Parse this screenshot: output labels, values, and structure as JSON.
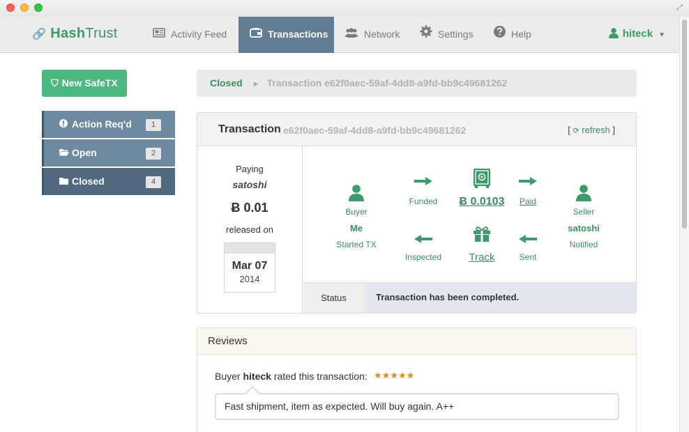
{
  "app": {
    "brand_part1": "Hash",
    "brand_part2": "Trust"
  },
  "nav": {
    "items": [
      {
        "label": "Activity Feed",
        "icon": "newspaper-icon"
      },
      {
        "label": "Transactions",
        "icon": "wallet-icon",
        "active": true
      },
      {
        "label": "Network",
        "icon": "users-icon"
      },
      {
        "label": "Settings",
        "icon": "gear-icon"
      },
      {
        "label": "Help",
        "icon": "question-icon"
      }
    ],
    "user": "hiteck"
  },
  "sidebar": {
    "new_button": "New SafeTX",
    "items": [
      {
        "label": "Action Req'd",
        "count": "1",
        "icon": "exclamation-icon"
      },
      {
        "label": "Open",
        "count": "2",
        "icon": "folder-open-icon"
      },
      {
        "label": "Closed",
        "count": "4",
        "icon": "folder-icon"
      }
    ]
  },
  "breadcrumb": {
    "section": "Closed",
    "current": "Transaction e62f0aec-59af-4dd8-a9fd-bb9c49681262"
  },
  "transaction": {
    "title": "Transaction",
    "id": "e62f0aec-59af-4dd8-a9fd-bb9c49681262",
    "refresh_label": "refresh",
    "paying_label": "Paying",
    "payee": "satoshi",
    "amount": "Ƀ 0.01",
    "released_label": "released on",
    "date_md": "Mar 07",
    "date_year": "2014",
    "flow": {
      "buyer_role": "Buyer",
      "buyer_name": "Me",
      "buyer_state": "Started TX",
      "funded": "Funded",
      "escrow_amount": "Ƀ 0.0103",
      "paid": "Paid",
      "seller_role": "Seller",
      "seller_name": "satoshi",
      "seller_state": "Notified",
      "inspected": "Inspected",
      "track": "Track",
      "sent": "Sent"
    },
    "status_label": "Status",
    "status_value": "Transaction has been completed."
  },
  "reviews": {
    "title": "Reviews",
    "prefix": "Buyer",
    "reviewer": "hiteck",
    "suffix": "rated this transaction:",
    "rating": 5,
    "comment": "Fast shipment, item as expected. Will buy again. A++"
  },
  "colors": {
    "brand_green": "#3d9a6b",
    "nav_active": "#627d93",
    "star": "#e88a1a"
  }
}
